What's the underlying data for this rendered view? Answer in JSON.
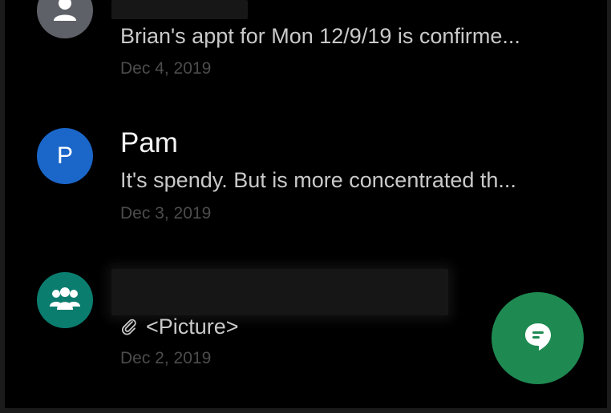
{
  "conversations": [
    {
      "avatar_icon": "person-icon",
      "avatar_color": "#5f6168",
      "name_hidden": true,
      "snippet": "Brian's appt for Mon 12/9/19 is confirme...",
      "date": "Dec 4, 2019"
    },
    {
      "avatar_letter": "P",
      "avatar_color": "#1a66c9",
      "name": "Pam",
      "snippet": "It's spendy. But is more concentrated th...",
      "date": "Dec 3, 2019"
    },
    {
      "avatar_icon": "group-icon",
      "avatar_color": "#0b7d6f",
      "name_hidden": true,
      "snippet": "<Picture>",
      "snippet_icon": "attachment-icon",
      "date": "Dec 2, 2019"
    }
  ],
  "fab": {
    "icon": "new-message-icon",
    "color": "#1e8a52"
  },
  "colors": {
    "background": "#000000",
    "name_text": "#f4f4f4",
    "snippet_text": "#c9c9c9",
    "date_text": "#4c4c4c"
  }
}
